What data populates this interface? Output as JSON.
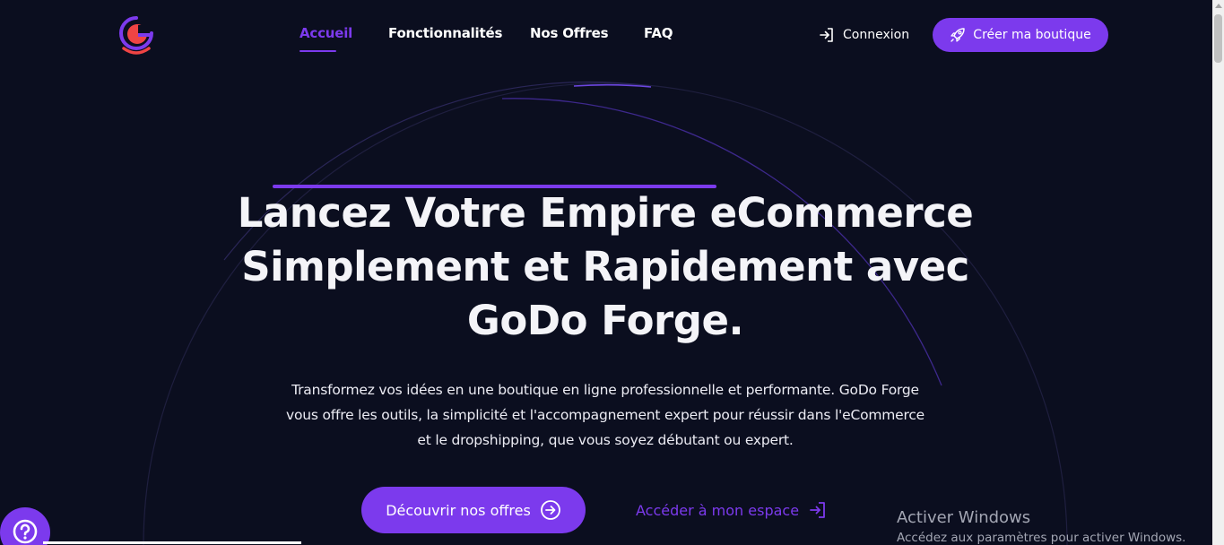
{
  "brand": {
    "logo_icon": "godo-forge-logo-icon",
    "colors": {
      "accent": "#7c3aed",
      "logo_red": "#ef4444",
      "background": "#0b0e1f"
    }
  },
  "nav": {
    "items": [
      {
        "label": "Accueil",
        "active": true
      },
      {
        "label": "Fonctionnalités",
        "active": false
      },
      {
        "label": "Nos Offres",
        "active": false
      },
      {
        "label": "FAQ",
        "active": false
      }
    ]
  },
  "header": {
    "login_label": "Connexion",
    "login_icon": "login-icon",
    "cta_label": "Créer ma boutique",
    "cta_icon": "rocket-icon"
  },
  "hero": {
    "title": "Lancez Votre Empire eCommerce Simplement et Rapidement avec GoDo Forge.",
    "subtitle": "Transformez vos idées en une boutique en ligne professionnelle et performante. GoDo Forge vous offre les outils, la simplicité et l'accompagnement expert pour réussir dans l'eCommerce et le dropshipping, que vous soyez débutant ou expert.",
    "primary_button": "Découvrir nos offres",
    "primary_icon": "arrow-right-circle-icon",
    "secondary_link": "Accéder à mon espace",
    "secondary_icon": "enter-icon"
  },
  "help": {
    "icon": "help-question-icon"
  },
  "watermark": {
    "title": "Activer Windows",
    "subtitle": "Accédez aux paramètres pour activer Windows."
  }
}
